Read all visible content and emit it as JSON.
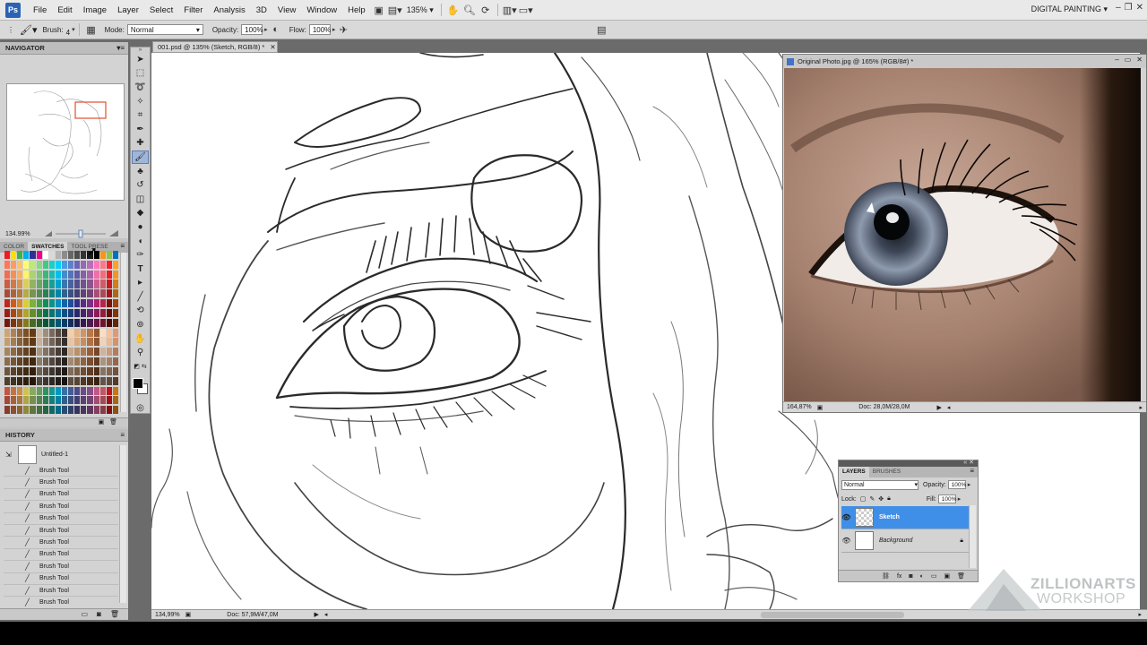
{
  "menubar": {
    "logo": "Ps",
    "items": [
      "File",
      "Edit",
      "Image",
      "Layer",
      "Select",
      "Filter",
      "Analysis",
      "3D",
      "View",
      "Window",
      "Help"
    ],
    "zoom": "135%",
    "workspace": "DIGITAL PAINTING"
  },
  "options": {
    "brush_label": "Brush:",
    "brush_size": "4",
    "mode_label": "Mode:",
    "mode_value": "Normal",
    "opacity_label": "Opacity:",
    "opacity_value": "100%",
    "flow_label": "Flow:",
    "flow_value": "100%"
  },
  "navigator": {
    "title": "NAVIGATOR",
    "zoom": "134.99%"
  },
  "swatches": {
    "tabs": [
      "COLOR",
      "SWATCHES",
      "TOOL PRESE"
    ],
    "colors_row1": [
      "#ed1c24",
      "#ffde00",
      "#39b54a",
      "#00aeef",
      "#2e3192",
      "#ec008c",
      "#ffffff",
      "#d9d9d9",
      "#b3b3b3",
      "#8c8c8c",
      "#666666",
      "#4d4d4d",
      "#333333",
      "#1a1a1a",
      "#000000",
      "#f7941d",
      "#8dc63f",
      "#0072bc"
    ],
    "palette": [
      "#f26c4f",
      "#f68e55",
      "#fbaf5c",
      "#fff467",
      "#acd372",
      "#7cc576",
      "#3bb878",
      "#1abbb4",
      "#00bff3",
      "#438ccb",
      "#5574b9",
      "#605ca8",
      "#855fa8",
      "#a763a8",
      "#f06ea9",
      "#f26d7d",
      "#ed1c24",
      "#f7941d",
      "#c1281d",
      "#cf5b1b",
      "#d7892a",
      "#d8cf34",
      "#7cb13a",
      "#46a144",
      "#0d8f5c",
      "#0c918b",
      "#0a8ebf",
      "#0e65a9",
      "#214d97",
      "#342f86",
      "#5b2a85",
      "#7b2e84",
      "#b02271",
      "#b8244c",
      "#7d1108",
      "#a1410d"
    ],
    "browns": [
      "#c69c6d",
      "#a67c52",
      "#8c6239",
      "#754c24",
      "#603913",
      "#c7b299",
      "#998675",
      "#736357",
      "#534741",
      "#362f2d",
      "#e6c5a5",
      "#d9a97c",
      "#c98d5b",
      "#b07043",
      "#8d5530",
      "#f2d3b8",
      "#eab893",
      "#d6926a"
    ]
  },
  "history": {
    "title": "HISTORY",
    "snapshot": "Untitled-1",
    "items": [
      "Brush Tool",
      "Brush Tool",
      "Brush Tool",
      "Brush Tool",
      "Brush Tool",
      "Brush Tool",
      "Brush Tool",
      "Brush Tool",
      "Brush Tool",
      "Brush Tool",
      "Brush Tool",
      "Brush Tool"
    ]
  },
  "document": {
    "tab": "001.psd @ 135% (Sketch, RGB/8) *",
    "zoom": "134,99%",
    "doc_size": "Doc: 57,9M/47,0M"
  },
  "photo": {
    "title": "Original Photo.jpg @ 165% (RGB/8#) *",
    "zoom": "164,87%",
    "doc_size": "Doc: 28,0M/28,0M"
  },
  "layers": {
    "tabs": [
      "LAYERS",
      "BRUSHES"
    ],
    "blend": "Normal",
    "opacity_label": "Opacity:",
    "opacity_value": "100%",
    "lock_label": "Lock:",
    "fill_label": "Fill:",
    "fill_value": "100%",
    "items": [
      {
        "name": "Sketch",
        "selected": true
      },
      {
        "name": "Background",
        "selected": false
      }
    ]
  },
  "watermark": {
    "line1": "ZILLIONARTS",
    "line2": "WORKSHOP"
  }
}
